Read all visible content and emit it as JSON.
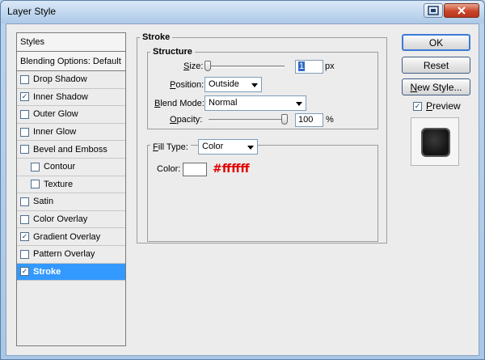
{
  "window": {
    "title": "Layer Style"
  },
  "styles": {
    "header": "Styles",
    "blending": "Blending Options: Default",
    "items": [
      {
        "label": "Drop Shadow",
        "checked": false,
        "sub": false,
        "selected": false
      },
      {
        "label": "Inner Shadow",
        "checked": true,
        "sub": false,
        "selected": false
      },
      {
        "label": "Outer Glow",
        "checked": false,
        "sub": false,
        "selected": false
      },
      {
        "label": "Inner Glow",
        "checked": false,
        "sub": false,
        "selected": false
      },
      {
        "label": "Bevel and Emboss",
        "checked": false,
        "sub": false,
        "selected": false
      },
      {
        "label": "Contour",
        "checked": false,
        "sub": true,
        "selected": false
      },
      {
        "label": "Texture",
        "checked": false,
        "sub": true,
        "selected": false
      },
      {
        "label": "Satin",
        "checked": false,
        "sub": false,
        "selected": false
      },
      {
        "label": "Color Overlay",
        "checked": false,
        "sub": false,
        "selected": false
      },
      {
        "label": "Gradient Overlay",
        "checked": true,
        "sub": false,
        "selected": false
      },
      {
        "label": "Pattern Overlay",
        "checked": false,
        "sub": false,
        "selected": false
      },
      {
        "label": "Stroke",
        "checked": true,
        "sub": false,
        "selected": true
      }
    ]
  },
  "stroke": {
    "title": "Stroke",
    "structure": {
      "title": "Structure",
      "size_label": "Size:",
      "size_value": "1",
      "size_unit": "px",
      "size_level": 0.0,
      "position_label": "Position:",
      "position_value": "Outside",
      "blend_label": "Blend Mode:",
      "blend_value": "Normal",
      "opacity_label": "Opacity:",
      "opacity_value": "100",
      "opacity_unit": "%",
      "opacity_level": 1.0
    },
    "fill": {
      "type_label": "Fill Type:",
      "type_value": "Color",
      "color_label": "Color:",
      "color_hex": "#ffffff",
      "annotation": "#ffffff"
    }
  },
  "buttons": {
    "ok": "OK",
    "reset": "Reset",
    "new_style": "New Style...",
    "preview": "Preview",
    "preview_checked": true
  },
  "colors": {
    "selection": "#3399ff",
    "annotation": "#e00000"
  }
}
